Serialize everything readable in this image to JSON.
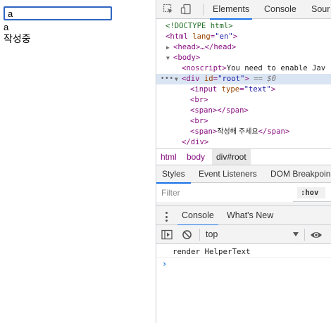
{
  "page": {
    "input_value": "a",
    "output_text": "a",
    "helper_text": "작성중"
  },
  "devtools": {
    "tabs": [
      "Elements",
      "Console",
      "Sour"
    ],
    "dom": {
      "doctype": "<!DOCTYPE html>",
      "html_open_tag": "<html",
      "html_attr": "lang",
      "html_attr_val": "\"en\"",
      "head_line": "<head>…</head>",
      "body_line": "<body>",
      "noscript_tag": "<noscript>",
      "noscript_text": "You need to enable Jav",
      "div_tag": "<div",
      "div_attr": "id",
      "div_attr_val": "\"root\"",
      "div_close": ">",
      "selected_marker": "== $0",
      "input_tag": "<input",
      "input_attr": "type",
      "input_attr_val": "\"text\"",
      "br_1": "<br>",
      "span_empty": "<span></span>",
      "br_2": "<br>",
      "span_open": "<span>",
      "span_text": "작성해 주세요",
      "span_close": "</span>",
      "div_end": "</div>"
    },
    "breadcrumbs": [
      "html",
      "body",
      "div#root"
    ],
    "subtabs": [
      "Styles",
      "Event Listeners",
      "DOM Breakpoin"
    ],
    "filter_placeholder": "Filter",
    "hov_label": ":hov",
    "drawer_tabs": [
      "Console",
      "What's New"
    ],
    "context": "top",
    "console_log": "render HelperText",
    "console_prompt": "›"
  }
}
